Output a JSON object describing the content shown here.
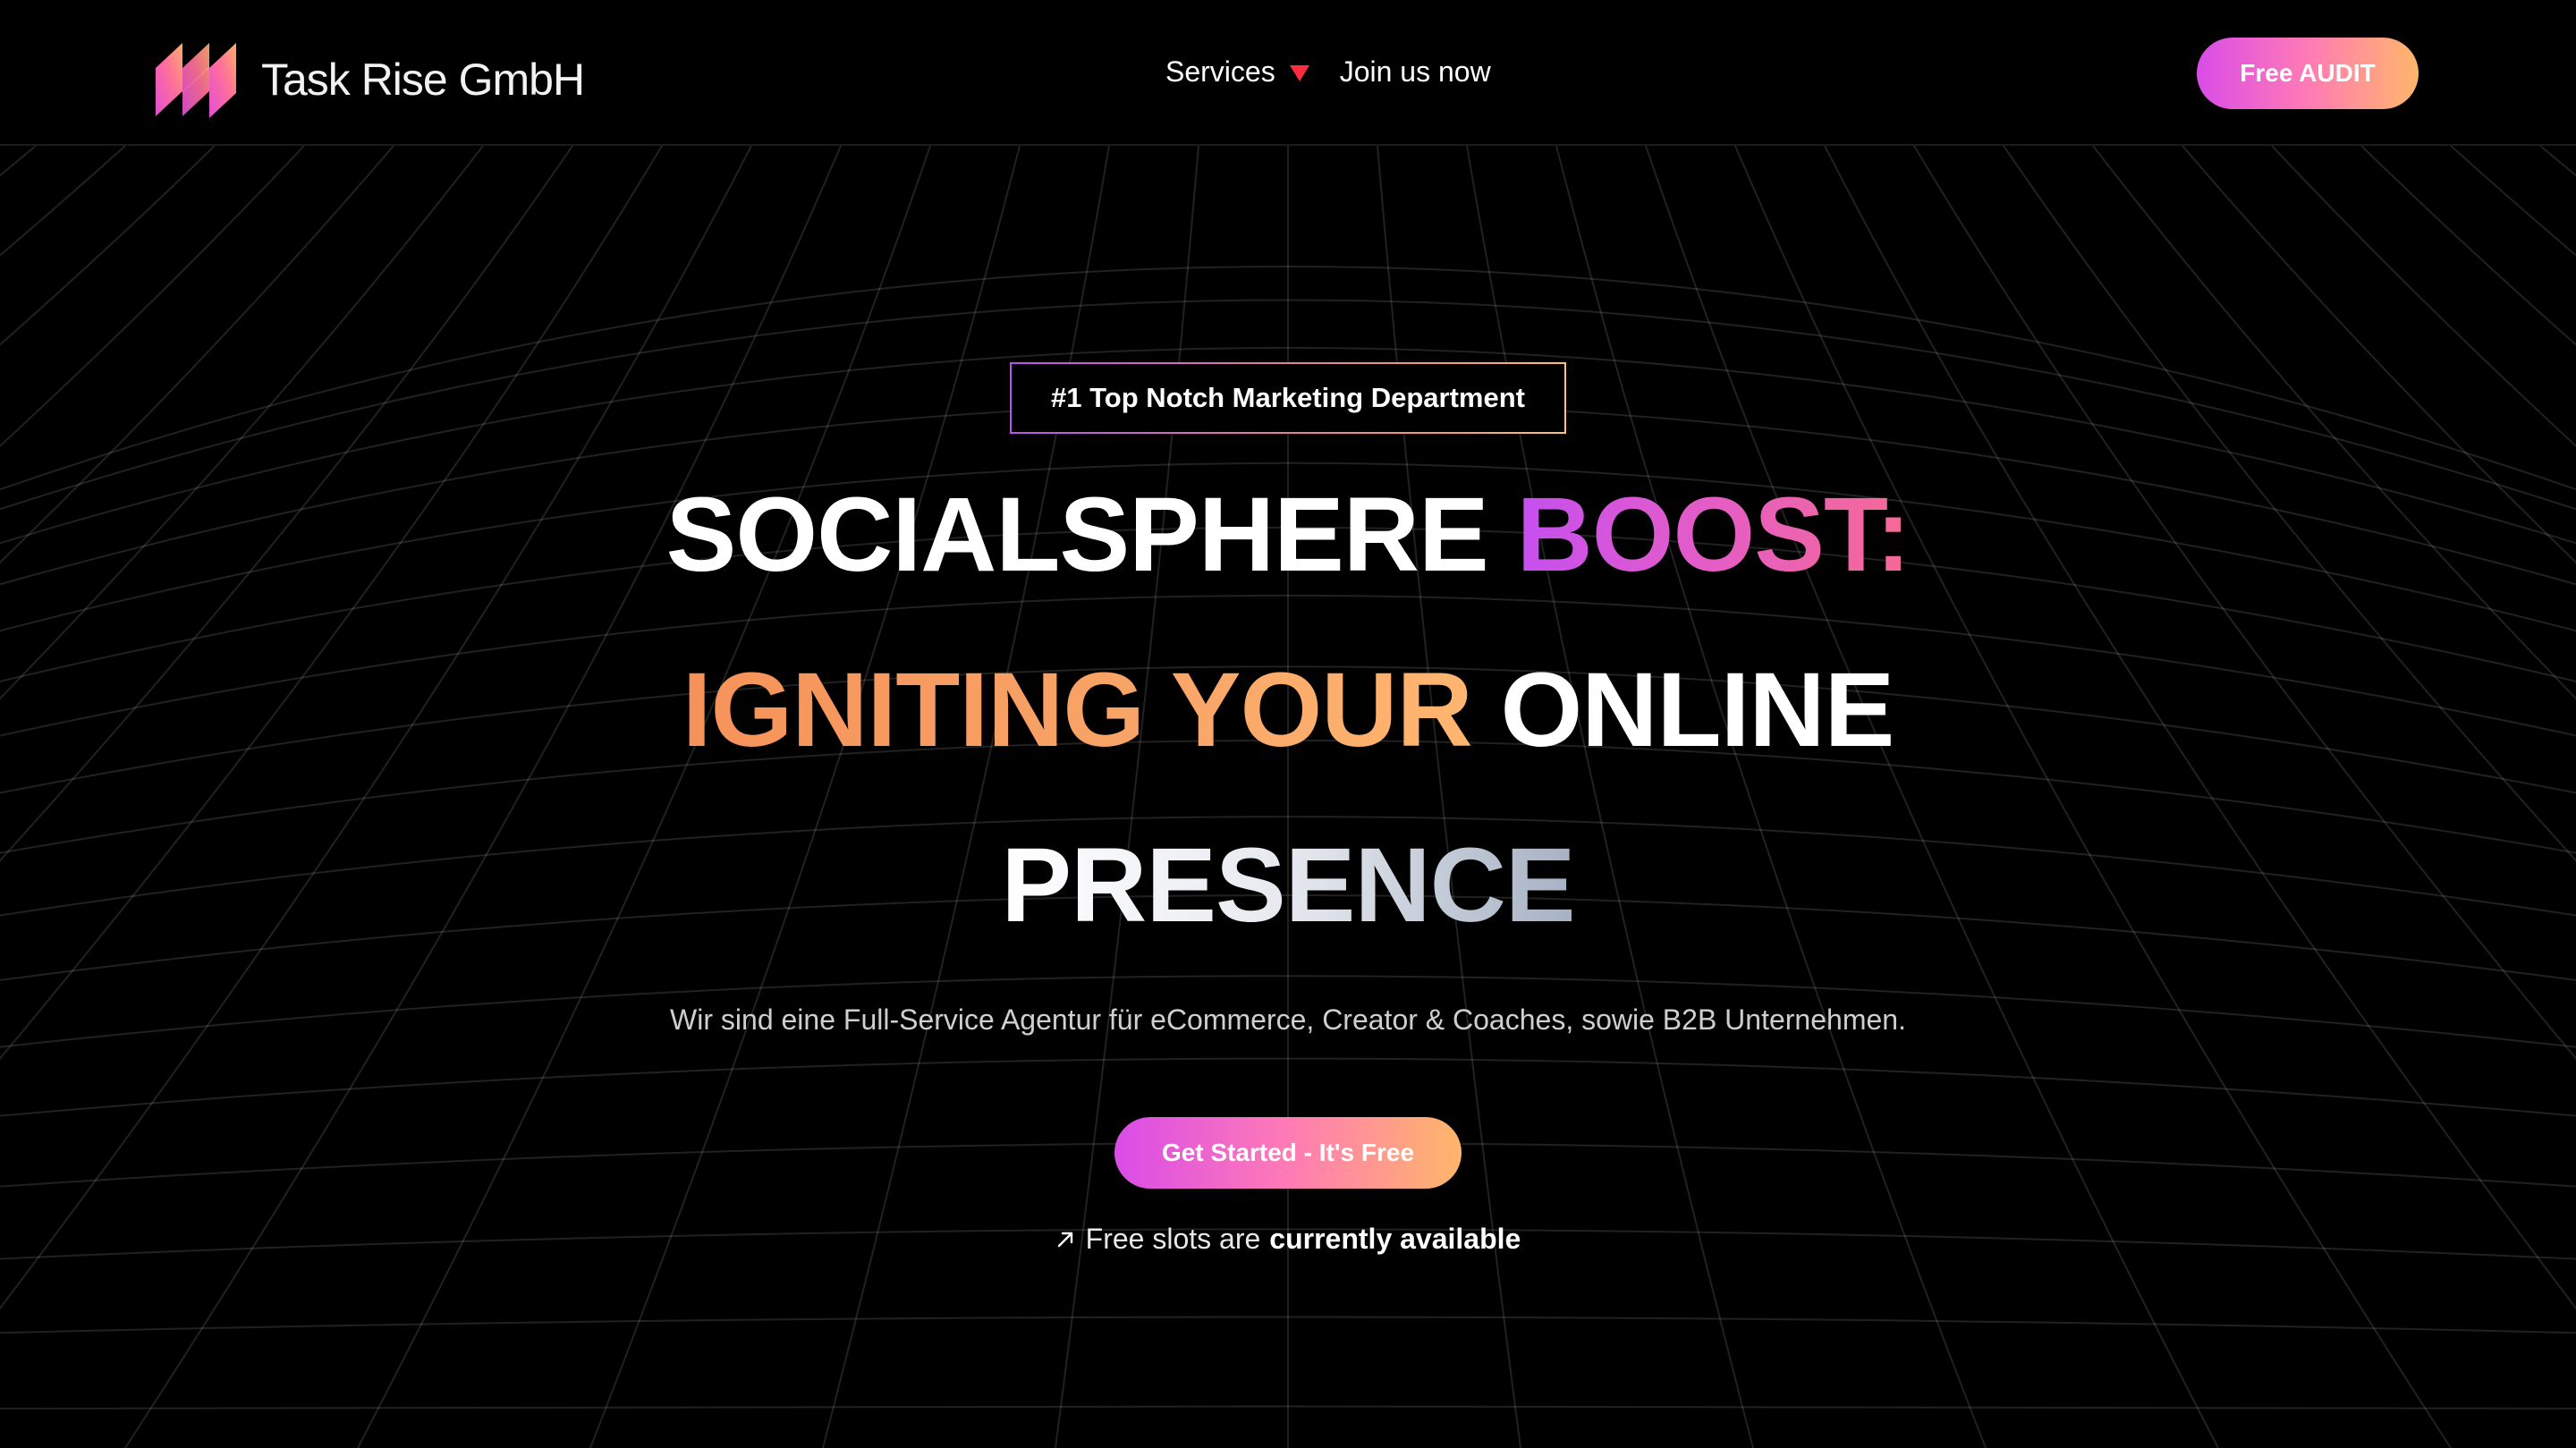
{
  "header": {
    "brand_name": "Task Rise GmbH",
    "logo_icon": "task-rise-logo",
    "nav": {
      "services_label": "Services",
      "services_icon": "caret-down-icon",
      "join_label": "Join us now"
    },
    "cta_label": "Free AUDIT"
  },
  "hero": {
    "badge": "#1 Top Notch Marketing Department",
    "title": {
      "line1_a": "SOCIALSPHERE",
      "line1_b": "BOOST:",
      "line2_a": "IGNITING YOUR",
      "line2_b": "ONLINE",
      "line3": "PRESENCE"
    },
    "subtitle": "Wir sind eine Full-Service Agentur für eCommerce, Creator & Coaches, sowie B2B Unternehmen.",
    "cta_label": "Get Started - It's Free",
    "slots_prefix": "Free slots are",
    "slots_strong": "currently available",
    "slots_icon": "arrow-up-right-icon"
  },
  "colors": {
    "background": "#000000",
    "gradient_start": "#d94ce8",
    "gradient_mid": "#ff7bb5",
    "gradient_end": "#ffb66a",
    "caret": "#ff2d3d"
  }
}
